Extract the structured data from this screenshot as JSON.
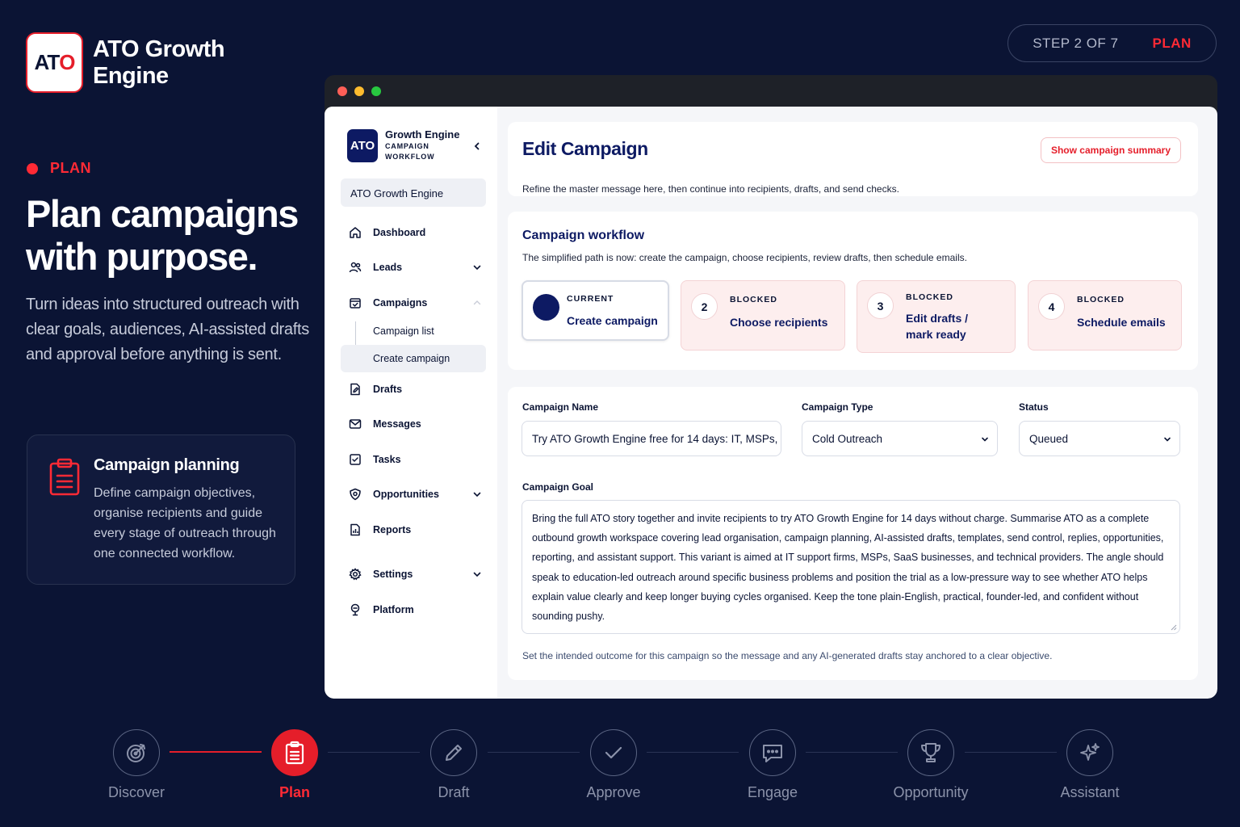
{
  "brand": {
    "logo_prefix": "AT",
    "logo_suffix": "O",
    "name_line1": "ATO Growth",
    "name_line2": "Engine"
  },
  "progress": {
    "count": "STEP 2 OF 7",
    "stage": "PLAN",
    "current_step": 2,
    "total_steps": 7
  },
  "hero": {
    "eyebrow": "PLAN",
    "headline": "Plan campaigns with purpose.",
    "subcopy": "Turn ideas into structured outreach with clear goals, audiences, AI-assisted drafts and approval before anything is sent."
  },
  "info_card": {
    "title": "Campaign planning",
    "body": "Define campaign objectives, organise recipients and guide every stage of outreach through one connected workflow."
  },
  "colors": {
    "accent": "#e51e2a",
    "navy": "#0d1a63",
    "background": "#0b1434"
  },
  "sidebar": {
    "logo": "ATO",
    "title": "Growth Engine",
    "subtitle_line1": "CAMPAIGN",
    "subtitle_line2": "WORKFLOW",
    "workspace": "ATO Growth Engine",
    "items": [
      {
        "label": "Dashboard",
        "icon": "home-icon"
      },
      {
        "label": "Leads",
        "icon": "users-icon"
      },
      {
        "label": "Campaigns",
        "icon": "calendar-check-icon"
      },
      {
        "label": "Campaign list"
      },
      {
        "label": "Create campaign"
      },
      {
        "label": "Drafts",
        "icon": "file-edit-icon"
      },
      {
        "label": "Messages",
        "icon": "mail-icon"
      },
      {
        "label": "Tasks",
        "icon": "checkbox-icon"
      },
      {
        "label": "Opportunities",
        "icon": "shield-icon"
      },
      {
        "label": "Reports",
        "icon": "report-icon"
      },
      {
        "label": "Settings",
        "icon": "gear-icon"
      },
      {
        "label": "Platform",
        "icon": "platform-icon"
      }
    ]
  },
  "header": {
    "title": "Edit Campaign",
    "description": "Refine the master message here, then continue into recipients, drafts, and send checks.",
    "summary_button": "Show campaign summary"
  },
  "workflow": {
    "title": "Campaign workflow",
    "description": "The simplified path is now: create the campaign, choose recipients, review drafts, then schedule emails.",
    "steps": [
      {
        "number": "",
        "state": "CURRENT",
        "name": "Create campaign"
      },
      {
        "number": "2",
        "state": "BLOCKED",
        "name": "Choose recipients"
      },
      {
        "number": "3",
        "state": "BLOCKED",
        "name_line1": "Edit drafts /",
        "name_line2": "mark ready"
      },
      {
        "number": "4",
        "state": "BLOCKED",
        "name": "Schedule emails"
      }
    ]
  },
  "form": {
    "name_label": "Campaign Name",
    "name_value": "Try ATO Growth Engine free for 14 days: IT, MSPs,",
    "type_label": "Campaign Type",
    "type_value": "Cold Outreach",
    "status_label": "Status",
    "status_value": "Queued",
    "goal_label": "Campaign Goal",
    "goal_value": "Bring the full ATO story together and invite recipients to try ATO Growth Engine for 14 days without charge. Summarise ATO as a complete outbound growth workspace covering lead organisation, campaign planning, AI-assisted drafts, templates, send control, replies, opportunities, reporting, and assistant support. This variant is aimed at IT support firms, MSPs, SaaS businesses, and technical providers. The angle should speak to education-led outreach around specific business problems and position the trial as a low-pressure way to see whether ATO helps explain value clearly and keep longer buying cycles organised. Keep the tone plain-English, practical, founder-led, and confident without sounding pushy.",
    "goal_hint": "Set the intended outcome for this campaign so the message and any AI-generated drafts stay anchored to a clear objective."
  },
  "stepper": [
    {
      "label": "Discover",
      "icon": "target-icon"
    },
    {
      "label": "Plan",
      "icon": "clipboard-icon"
    },
    {
      "label": "Draft",
      "icon": "pencil-icon"
    },
    {
      "label": "Approve",
      "icon": "check-icon"
    },
    {
      "label": "Engage",
      "icon": "chat-icon"
    },
    {
      "label": "Opportunity",
      "icon": "trophy-icon"
    },
    {
      "label": "Assistant",
      "icon": "sparkle-icon"
    }
  ]
}
